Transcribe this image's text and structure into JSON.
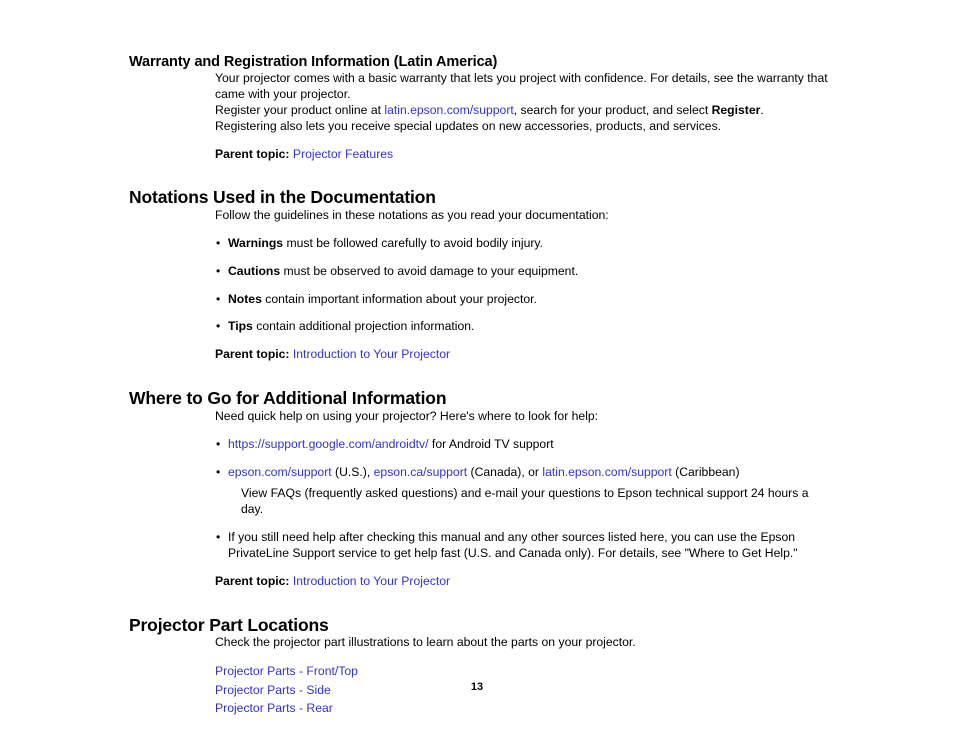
{
  "page": {
    "number": "13",
    "link_color": "#3333cc",
    "text_color": "#000000",
    "background_color": "#ffffff"
  },
  "sections": [
    {
      "id": "warranty-registration",
      "level": "minor",
      "heading": "Warranty and Registration Information (Latin America)",
      "paragraphs": {
        "p1": "Your projector comes with a basic warranty that lets you project with confidence. For details, see the warranty that came with your projector.",
        "p2_pre": "Register your product online at ",
        "p2_link": "latin.epson.com/support",
        "p2_mid": ", search for your product, and select ",
        "p2_bold": "Register",
        "p2_post": ".",
        "p3": "Registering also lets you receive special updates on new accessories, products, and services."
      },
      "parent_topic": {
        "label": "Parent topic:",
        "link": "Projector Features"
      }
    },
    {
      "id": "notations-used",
      "level": "major",
      "heading": "Notations Used in the Documentation",
      "intro": "Follow the guidelines in these notations as you read your documentation:",
      "bullets": [
        {
          "bold": "Warnings",
          "rest": " must be followed carefully to avoid bodily injury."
        },
        {
          "bold": "Cautions",
          "rest": " must be observed to avoid damage to your equipment."
        },
        {
          "bold": "Notes",
          "rest": " contain important information about your projector."
        },
        {
          "bold": "Tips",
          "rest": " contain additional projection information."
        }
      ],
      "bullet_marker": "•",
      "parent_topic": {
        "label": "Parent topic:",
        "link": "Introduction to Your Projector"
      }
    },
    {
      "id": "where-to-go",
      "level": "major",
      "heading": "Where to Go for Additional Information",
      "intro": "Need quick help on using your projector? Here's where to look for help:",
      "bullet_marker": "•",
      "bullet1": {
        "link": "https://support.google.com/androidtv/",
        "rest": " for Android TV support"
      },
      "bullet2": {
        "link1": "epson.com/support",
        "t1": " (U.S.), ",
        "link2": "epson.ca/support",
        "t2": " (Canada), or ",
        "link3": "latin.epson.com/support",
        "t3": " (Caribbean)",
        "sub": "View FAQs (frequently asked questions) and e-mail your questions to Epson technical support 24 hours a day."
      },
      "bullet3": {
        "text": "If you still need help after checking this manual and any other sources listed here, you can use the Epson PrivateLine Support service to get help fast (U.S. and Canada only). For details, see \"Where to Get Help.\""
      },
      "parent_topic": {
        "label": "Parent topic:",
        "link": "Introduction to Your Projector"
      }
    },
    {
      "id": "projector-part-locations",
      "level": "major",
      "heading": "Projector Part Locations",
      "intro": "Check the projector part illustrations to learn about the parts on your projector.",
      "links": [
        "Projector Parts - Front/Top",
        "Projector Parts - Side",
        "Projector Parts - Rear"
      ]
    }
  ]
}
